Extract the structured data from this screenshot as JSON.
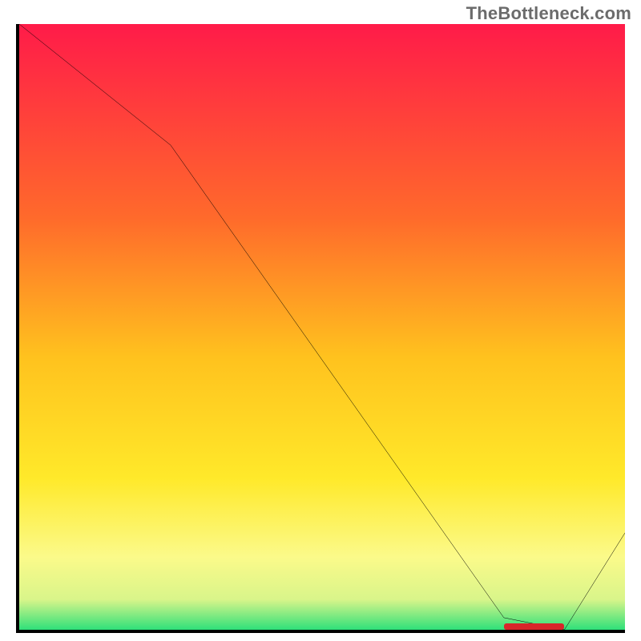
{
  "attribution": "TheBottleneck.com",
  "chart_data": {
    "type": "line",
    "title": "",
    "xlabel": "",
    "ylabel": "",
    "xlim": [
      0,
      100
    ],
    "ylim": [
      0,
      100
    ],
    "series": [
      {
        "name": "curve",
        "x": [
          0,
          25,
          80,
          90,
          100
        ],
        "values": [
          100,
          80,
          2,
          0,
          16
        ]
      }
    ],
    "gradient_stops": [
      {
        "pos": 0.0,
        "color": "#ff1b49"
      },
      {
        "pos": 0.32,
        "color": "#ff6a2b"
      },
      {
        "pos": 0.55,
        "color": "#ffc21e"
      },
      {
        "pos": 0.75,
        "color": "#ffe92a"
      },
      {
        "pos": 0.88,
        "color": "#fbfa8a"
      },
      {
        "pos": 0.95,
        "color": "#d9f58a"
      },
      {
        "pos": 1.0,
        "color": "#2fe07a"
      }
    ],
    "marker": {
      "x_start": 80,
      "x_end": 90,
      "y": 0
    }
  }
}
